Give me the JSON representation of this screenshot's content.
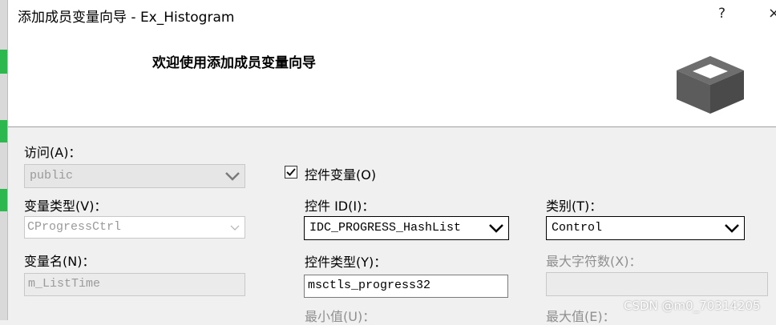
{
  "window": {
    "title": "添加成员变量向导 - Ex_Histogram",
    "help_label": "?",
    "close_label": "×"
  },
  "header": {
    "welcome_text": "欢迎使用添加成员变量向导",
    "icon": "box-icon"
  },
  "form": {
    "access": {
      "label": "访问(A)：",
      "value": "public",
      "enabled": false
    },
    "variable_type": {
      "label": "变量类型(V)：",
      "value": "CProgressCtrl",
      "enabled": false
    },
    "variable_name": {
      "label": "变量名(N)：",
      "value": "m_ListTime",
      "enabled": false
    },
    "control_variable": {
      "label": "控件变量(O)",
      "checked": true
    },
    "control_id": {
      "label": "控件 ID(I)：",
      "value": "IDC_PROGRESS_HashList"
    },
    "control_type": {
      "label": "控件类型(Y)：",
      "value": "msctls_progress32"
    },
    "min_value": {
      "label": "最小值(U)：",
      "enabled": false
    },
    "category": {
      "label": "类别(T)：",
      "value": "Control"
    },
    "max_chars": {
      "label": "最大字符数(X)：",
      "value": "",
      "enabled": false
    },
    "max_value": {
      "label": "最大值(E)：",
      "enabled": false
    }
  },
  "watermark": "CSDN @m0_70314205",
  "colors": {
    "accent_green": "#2db84d",
    "disabled_text": "#8f8f8f"
  }
}
